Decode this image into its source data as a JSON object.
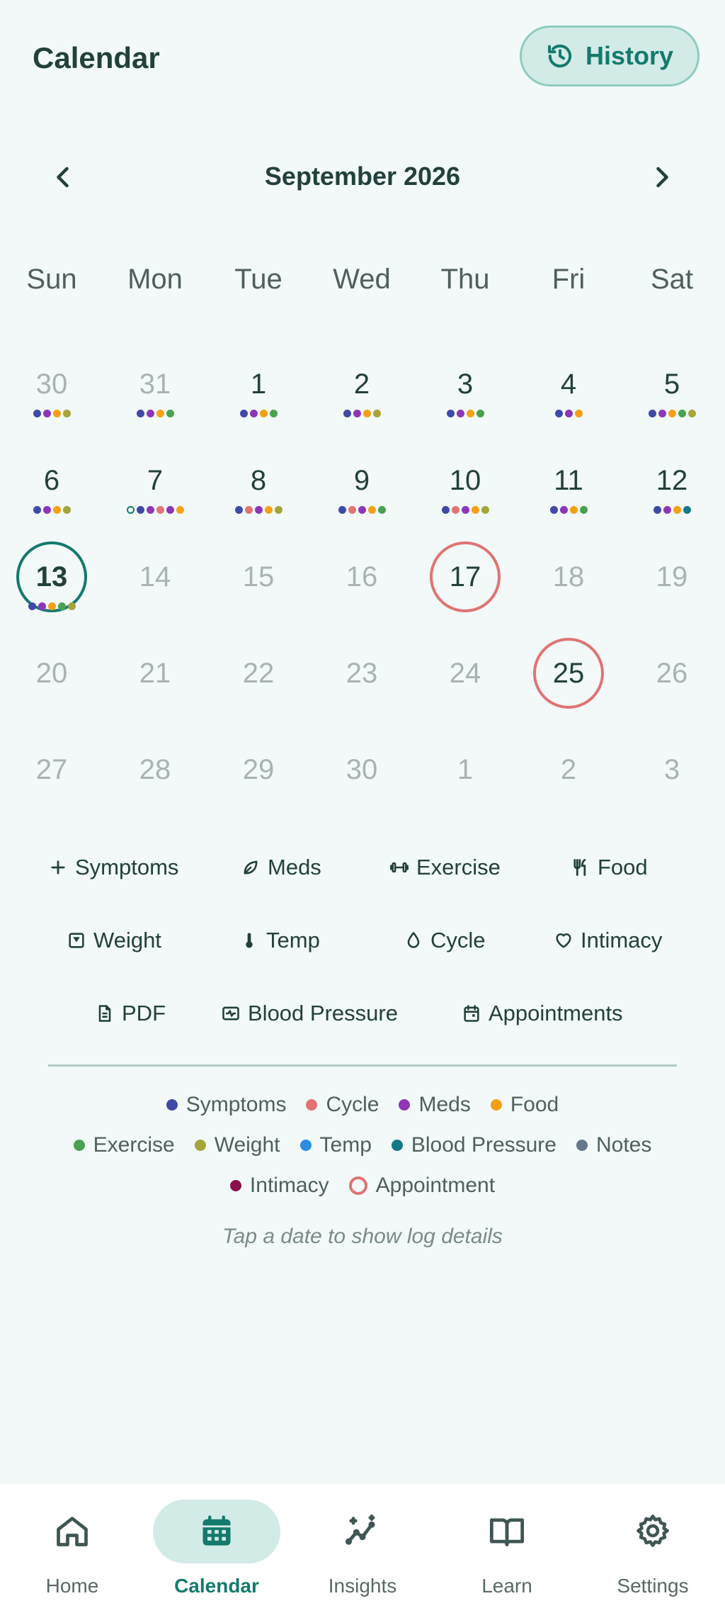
{
  "header": {
    "title": "Calendar",
    "history_label": "History"
  },
  "month_nav": {
    "label": "September 2026"
  },
  "weekdays": [
    "Sun",
    "Mon",
    "Tue",
    "Wed",
    "Thu",
    "Fri",
    "Sat"
  ],
  "colors": {
    "symptoms": "#3f4aa8",
    "cycle": "#e07474",
    "meds": "#8e36b7",
    "food": "#f5a014",
    "exercise": "#48a24f",
    "weight": "#a5a53a",
    "temp": "#2b8de0",
    "bp": "#137a87",
    "notes": "#65788a",
    "intimacy": "#8a114d",
    "appointment": "#e07474",
    "accent": "#137a6d"
  },
  "weeks": [
    [
      {
        "n": "30",
        "muted": true,
        "dots": [
          "symptoms",
          "meds",
          "food",
          "weight"
        ]
      },
      {
        "n": "31",
        "muted": true,
        "dots": [
          "symptoms",
          "meds",
          "food",
          "exercise"
        ]
      },
      {
        "n": "1",
        "dots": [
          "symptoms",
          "meds",
          "food",
          "exercise"
        ]
      },
      {
        "n": "2",
        "dots": [
          "symptoms",
          "meds",
          "food",
          "weight"
        ]
      },
      {
        "n": "3",
        "dots": [
          "symptoms",
          "meds",
          "food",
          "exercise"
        ]
      },
      {
        "n": "4",
        "dots": [
          "symptoms",
          "meds",
          "food"
        ]
      },
      {
        "n": "5",
        "dots": [
          "symptoms",
          "meds",
          "food",
          "exercise",
          "weight"
        ]
      }
    ],
    [
      {
        "n": "6",
        "dots": [
          "symptoms",
          "meds",
          "food",
          "weight"
        ]
      },
      {
        "n": "7",
        "dots": [
          "ring",
          "symptoms",
          "meds",
          "cycle",
          "meds",
          "food"
        ]
      },
      {
        "n": "8",
        "dots": [
          "symptoms",
          "cycle",
          "meds",
          "food",
          "weight"
        ]
      },
      {
        "n": "9",
        "dots": [
          "symptoms",
          "cycle",
          "meds",
          "food",
          "exercise"
        ]
      },
      {
        "n": "10",
        "dots": [
          "symptoms",
          "cycle",
          "meds",
          "food",
          "weight"
        ]
      },
      {
        "n": "11",
        "dots": [
          "symptoms",
          "meds",
          "food",
          "exercise"
        ]
      },
      {
        "n": "12",
        "dots": [
          "symptoms",
          "meds",
          "food",
          "bp"
        ]
      }
    ],
    [
      {
        "n": "13",
        "today": true,
        "dots": [
          "symptoms",
          "meds",
          "food",
          "exercise",
          "weight"
        ]
      },
      {
        "n": "14",
        "muted": true,
        "dots": []
      },
      {
        "n": "15",
        "muted": true,
        "dots": []
      },
      {
        "n": "16",
        "muted": true,
        "dots": []
      },
      {
        "n": "17",
        "appt": true,
        "dots": []
      },
      {
        "n": "18",
        "muted": true,
        "dots": []
      },
      {
        "n": "19",
        "muted": true,
        "dots": []
      }
    ],
    [
      {
        "n": "20",
        "muted": true,
        "dots": []
      },
      {
        "n": "21",
        "muted": true,
        "dots": []
      },
      {
        "n": "22",
        "muted": true,
        "dots": []
      },
      {
        "n": "23",
        "muted": true,
        "dots": []
      },
      {
        "n": "24",
        "muted": true,
        "dots": []
      },
      {
        "n": "25",
        "appt": true,
        "dots": []
      },
      {
        "n": "26",
        "muted": true,
        "dots": []
      }
    ],
    [
      {
        "n": "27",
        "muted": true,
        "dots": []
      },
      {
        "n": "28",
        "muted": true,
        "dots": []
      },
      {
        "n": "29",
        "muted": true,
        "dots": []
      },
      {
        "n": "30",
        "muted": true,
        "dots": []
      },
      {
        "n": "1",
        "muted": true,
        "dots": []
      },
      {
        "n": "2",
        "muted": true,
        "dots": []
      },
      {
        "n": "3",
        "muted": true,
        "dots": []
      }
    ]
  ],
  "quick_log": {
    "symptoms": "Symptoms",
    "meds": "Meds",
    "exercise": "Exercise",
    "food": "Food",
    "weight": "Weight",
    "temp": "Temp",
    "cycle": "Cycle",
    "intimacy": "Intimacy",
    "pdf": "PDF",
    "blood_pressure": "Blood Pressure",
    "appointments": "Appointments"
  },
  "legend": {
    "symptoms": "Symptoms",
    "cycle": "Cycle",
    "meds": "Meds",
    "food": "Food",
    "exercise": "Exercise",
    "weight": "Weight",
    "temp": "Temp",
    "blood_pressure": "Blood Pressure",
    "notes": "Notes",
    "intimacy": "Intimacy",
    "appointment": "Appointment"
  },
  "hint": "Tap a date to show log details",
  "bottom_nav": {
    "home": "Home",
    "calendar": "Calendar",
    "insights": "Insights",
    "learn": "Learn",
    "settings": "Settings"
  }
}
